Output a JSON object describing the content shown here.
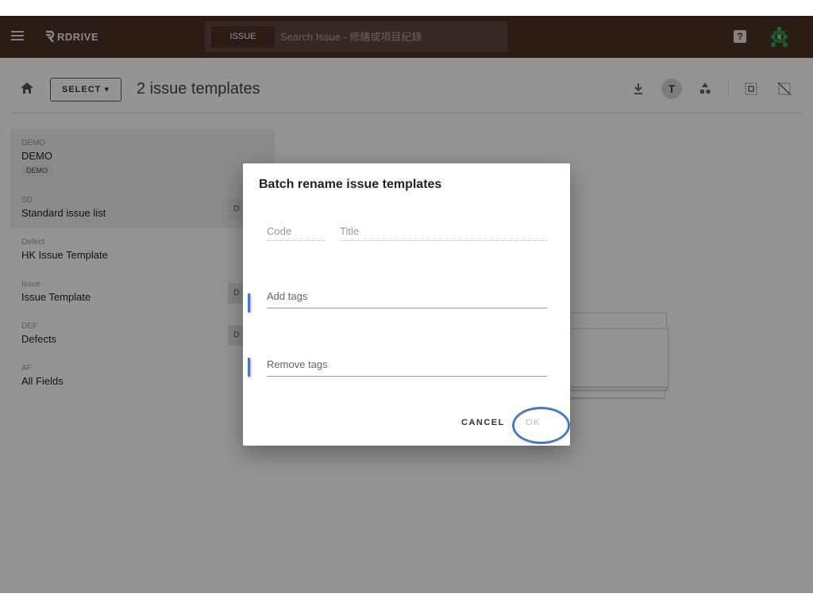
{
  "topbar": {
    "logo_text": "RDRIVE",
    "search_scope": "ISSUE",
    "search_placeholder": "Search Issue - 修繕或項目紀錄",
    "help_label": "?"
  },
  "header": {
    "select_label": "SELECT ▾",
    "title": "2 issue templates",
    "tool_text_label": "T"
  },
  "list": {
    "items": [
      {
        "code": "DEMO",
        "name": "DEMO",
        "tag": "DEMO",
        "chip": ""
      },
      {
        "code": "SD",
        "name": "Standard issue list",
        "tag": "",
        "chip": "D"
      },
      {
        "code": "Defect",
        "name": "HK Issue Template",
        "tag": "",
        "chip": ""
      },
      {
        "code": "Issue",
        "name": "Issue Template",
        "tag": "",
        "chip": "D"
      },
      {
        "code": "DEF",
        "name": "Defects",
        "tag": "",
        "chip": "D"
      },
      {
        "code": "AF",
        "name": "All Fields",
        "tag": "",
        "chip": ""
      }
    ]
  },
  "dialog": {
    "title": "Batch rename issue templates",
    "code_placeholder": "Code",
    "title_placeholder": "Title",
    "add_tags_placeholder": "Add tags",
    "remove_tags_placeholder": "Remove tags",
    "cancel_label": "CANCEL",
    "ok_label": "OK"
  },
  "colors": {
    "topbar": "#4a3126",
    "accent": "#4a78c4"
  }
}
